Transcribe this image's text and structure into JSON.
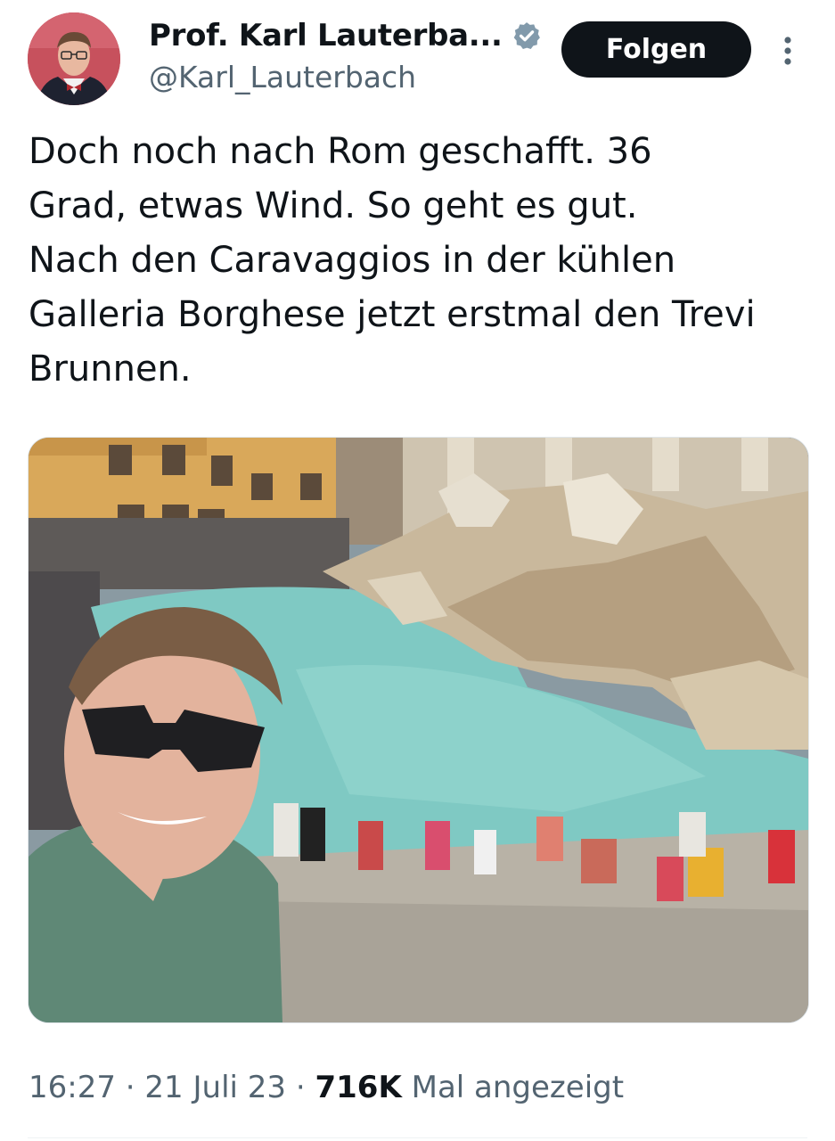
{
  "author": {
    "display_name": "Prof. Karl Lauterba...",
    "handle": "@Karl_Lauterbach"
  },
  "header": {
    "follow_label": "Folgen"
  },
  "tweet": {
    "text": "Doch noch nach Rom geschafft. 36\nGrad, etwas Wind. So geht es gut.\nNach den Caravaggios in der kühlen\nGalleria Borghese jetzt erstmal den Trevi\nBrunnen."
  },
  "meta": {
    "time": "16:27",
    "separator": "·",
    "date": "21 Juli 23",
    "views": "716K",
    "views_label": "Mal angezeigt"
  },
  "colors": {
    "text_primary": "#0f1419",
    "text_secondary": "#536471",
    "verified_badge": "#829aab",
    "follow_bg": "#0f1419",
    "fountain_water": "#7fc9c3"
  },
  "icons": {
    "verified": "verified-badge-icon",
    "more": "more-vertical-icon"
  }
}
